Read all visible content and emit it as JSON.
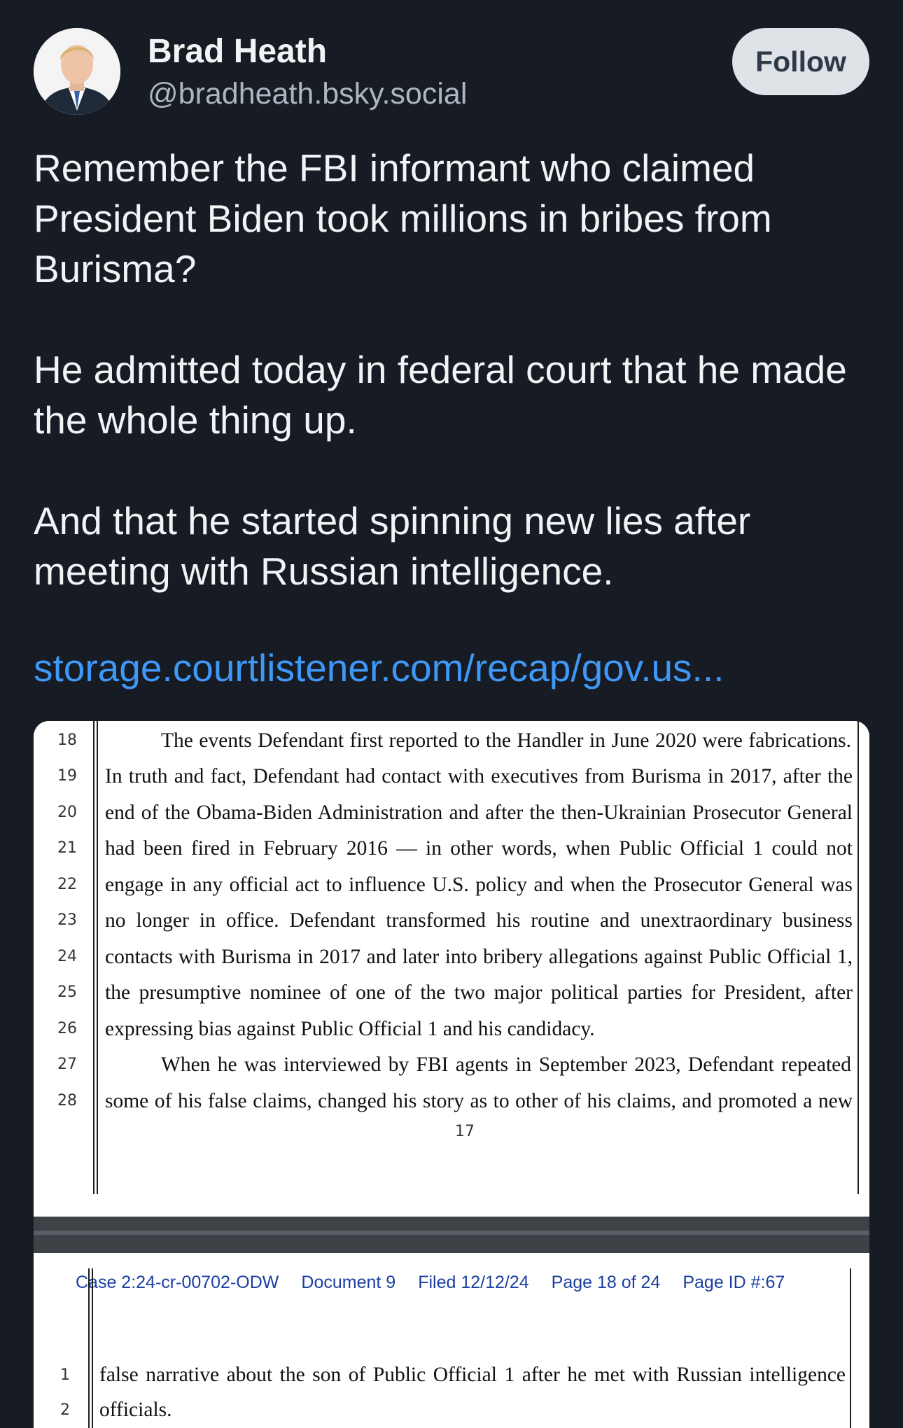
{
  "author": {
    "name": "Brad Heath",
    "handle": "@bradheath.bsky.social"
  },
  "follow_label": "Follow",
  "post": {
    "paragraphs": [
      "Remember the FBI informant who claimed President Biden took millions in bribes from Burisma?",
      "He admitted today in federal court that he made the whole thing up.",
      "And that he started spinning new lies after meeting with Russian intelligence."
    ],
    "link": "storage.courtlistener.com/recap/gov.us..."
  },
  "document": {
    "page1_lines": [
      {
        "n": "18",
        "text": "The events Defendant first reported to the Handler in June 2020 were fabrications."
      },
      {
        "n": "19",
        "text": "In truth and fact, Defendant had contact with executives from Burisma in 2017, after the"
      },
      {
        "n": "20",
        "text": "end of the Obama-Biden Administration and after the then-Ukrainian Prosecutor General"
      },
      {
        "n": "21",
        "text": "had been fired in February 2016 — in other words, when Public Official 1 could not"
      },
      {
        "n": "22",
        "text": "engage in any official act to influence U.S. policy and when the Prosecutor General was"
      },
      {
        "n": "23",
        "text": "no longer in office.  Defendant transformed his routine and unextraordinary business"
      },
      {
        "n": "24",
        "text": "contacts with Burisma in 2017 and later into bribery allegations against Public Official 1,"
      },
      {
        "n": "25",
        "text": "the presumptive nominee of one of the two major political parties for President, after"
      },
      {
        "n": "26",
        "text": "expressing bias against Public Official 1 and his candidacy."
      },
      {
        "n": "27",
        "text": "When he was interviewed by FBI agents in September 2023, Defendant repeated"
      },
      {
        "n": "28",
        "text": "some of his false claims, changed his story as to other of his claims, and promoted a new"
      }
    ],
    "page_number": "17",
    "case_header": {
      "case": "Case 2:24-cr-00702-ODW",
      "document": "Document 9",
      "filed": "Filed 12/12/24",
      "page": "Page 18 of 24",
      "page_id": "Page ID #:67"
    },
    "page2_lines": [
      {
        "n": "1",
        "text": "false narrative about the son of Public Official 1 after he met with Russian intelligence"
      },
      {
        "n": "2",
        "text": "officials."
      }
    ]
  }
}
